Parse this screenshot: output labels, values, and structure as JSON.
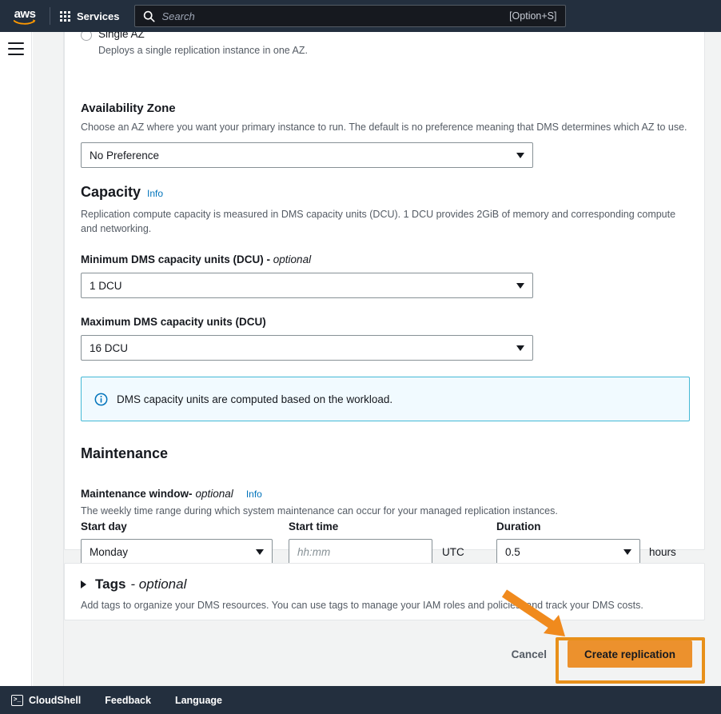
{
  "topnav": {
    "logo_alt": "aws",
    "services_label": "Services",
    "search_placeholder": "Search",
    "search_shortcut": "[Option+S]"
  },
  "form": {
    "single_az": {
      "label": "Single AZ",
      "description": "Deploys a single replication instance in one AZ."
    },
    "availability_zone": {
      "heading": "Availability Zone",
      "description": "Choose an AZ where you want your primary instance to run. The default is no preference meaning that DMS determines which AZ to use.",
      "value": "No Preference"
    },
    "capacity": {
      "heading": "Capacity",
      "info_label": "Info",
      "description": "Replication compute capacity is measured in DMS capacity units (DCU). 1 DCU provides 2GiB of memory and corresponding compute and networking.",
      "min_dcu_label": "Minimum DMS capacity units (DCU) -",
      "min_dcu_optional": "optional",
      "min_dcu_value": "1 DCU",
      "max_dcu_label": "Maximum DMS capacity units (DCU)",
      "max_dcu_value": "16 DCU",
      "alert_text": "DMS capacity units are computed based on the workload."
    },
    "maintenance": {
      "heading": "Maintenance",
      "window_label": "Maintenance window-",
      "window_optional": "optional",
      "info_label": "Info",
      "window_description": "The weekly time range during which system maintenance can occur for your managed replication instances.",
      "start_day_label": "Start day",
      "start_day_value": "Monday",
      "start_time_label": "Start time",
      "start_time_placeholder": "hh:mm",
      "start_time_value": "",
      "timezone_label": "UTC",
      "duration_label": "Duration",
      "duration_value": "0.5",
      "duration_unit": "hours"
    }
  },
  "tags": {
    "title": "Tags",
    "optional": "- optional",
    "description": "Add tags to organize your DMS resources. You can use tags to manage your IAM roles and policies, and track your DMS costs."
  },
  "actions": {
    "cancel_label": "Cancel",
    "create_label": "Create replication"
  },
  "footer": {
    "cloudshell_label": "CloudShell",
    "feedback_label": "Feedback",
    "language_label": "Language"
  },
  "colors": {
    "nav_background": "#232f3e",
    "primary_button": "#ec912d",
    "annotation_highlight": "#e8901a",
    "link_blue": "#0073bb",
    "alert_border": "#44b9d6",
    "alert_background": "#f1faff"
  }
}
